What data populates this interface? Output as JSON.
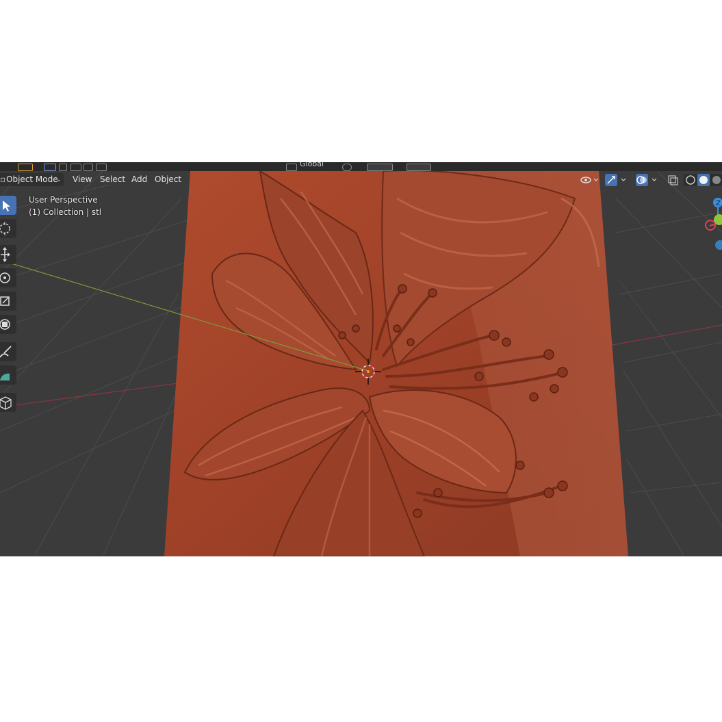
{
  "header": {
    "mode_label": "Object Mode",
    "menu": [
      "View",
      "Select",
      "Add",
      "Object"
    ],
    "transform_orientation": "Global"
  },
  "viewport": {
    "view_name": "User Perspective",
    "collection_label": "(1) Collection | stl"
  },
  "gizmo": {
    "z_label": "Z"
  },
  "colors": {
    "header_bg": "#2a2a2a",
    "viewport_bg": "#3b3b3b",
    "model_color": "#a0452c",
    "active_tool": "#4772b3",
    "axis_x": "#e0405a",
    "axis_y": "#8bc63c",
    "axis_z": "#3b8fdc"
  },
  "toolbar": {
    "tools": [
      "select-box-tool",
      "cursor-tool",
      "move-tool",
      "rotate-tool",
      "scale-tool",
      "transform-tool",
      "annotate-tool",
      "measure-tool",
      "add-cube-tool"
    ],
    "active": "select-box-tool"
  }
}
